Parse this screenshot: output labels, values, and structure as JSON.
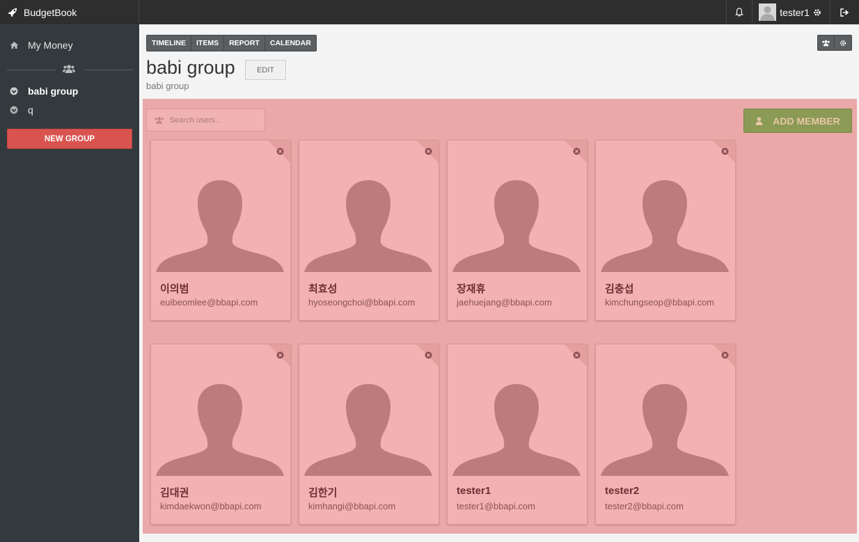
{
  "app": {
    "brand": "BudgetBook",
    "brand_icon": "rocket-icon"
  },
  "topbar": {
    "user_name": "tester1",
    "icons": [
      "bell-icon",
      "user-avatar",
      "gear-icon",
      "sign-out-icon"
    ]
  },
  "sidebar": {
    "my_money": "My Money",
    "groups": [
      {
        "label": "babi group",
        "active": true
      },
      {
        "label": "q",
        "active": false
      }
    ],
    "new_group": "NEW GROUP"
  },
  "tabs": [
    "TIMELINE",
    "ITEMS",
    "REPORT",
    "CALENDAR"
  ],
  "header": {
    "title": "babi group",
    "edit": "EDIT",
    "subtitle": "babi group"
  },
  "search": {
    "placeholder": "Search users..."
  },
  "add_member": "ADD MEMBER",
  "members": [
    {
      "name": "이의범",
      "email": "euibeomlee@bbapi.com"
    },
    {
      "name": "최효성",
      "email": "hyoseongchoi@bbapi.com"
    },
    {
      "name": "장재휴",
      "email": "jaehuejang@bbapi.com"
    },
    {
      "name": "김충섭",
      "email": "kimchungseop@bbapi.com"
    },
    {
      "name": "김대권",
      "email": "kimdaekwon@bbapi.com"
    },
    {
      "name": "김한기",
      "email": "kimhangi@bbapi.com"
    },
    {
      "name": "tester1",
      "email": "tester1@bbapi.com"
    },
    {
      "name": "tester2",
      "email": "tester2@bbapi.com"
    }
  ],
  "colors": {
    "panel_bg": "#eaa8a8",
    "card_bg": "#f3b1b1",
    "silhouette": "#bf7b7b",
    "add_member_bg": "#8b9a55",
    "new_group_bg": "#d9534f",
    "sidebar_bg": "#333a3d"
  }
}
